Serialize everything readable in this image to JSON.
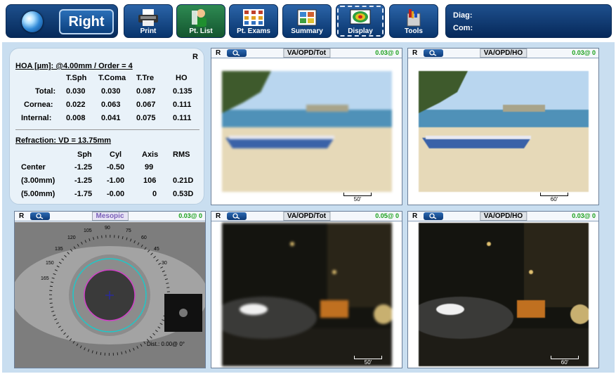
{
  "toolbar": {
    "eye_button": {
      "label": "Right"
    },
    "buttons": [
      {
        "label": "Print",
        "icon": "printer-icon"
      },
      {
        "label": "Pt. List",
        "icon": "patient-icon"
      },
      {
        "label": "Pt. Exams",
        "icon": "exams-grid-icon"
      },
      {
        "label": "Summary",
        "icon": "summary-icon"
      },
      {
        "label": "Display",
        "icon": "display-map-icon"
      },
      {
        "label": "Tools",
        "icon": "tools-icon"
      }
    ],
    "diag_label": "Diag:",
    "com_label": "Com:"
  },
  "info": {
    "eye": "R",
    "hoa_title": "HOA [µm]: @4.00mm / Order = 4",
    "hoa_headers": [
      "T.Sph",
      "T.Coma",
      "T.Tre",
      "HO"
    ],
    "hoa_rows": [
      {
        "label": "Total:",
        "values": [
          "0.030",
          "0.030",
          "0.087",
          "0.135"
        ]
      },
      {
        "label": "Cornea:",
        "values": [
          "0.022",
          "0.063",
          "0.067",
          "0.111"
        ]
      },
      {
        "label": "Internal:",
        "values": [
          "0.008",
          "0.041",
          "0.075",
          "0.111"
        ]
      }
    ],
    "refr_title": "Refraction: VD = 13.75mm",
    "refr_headers": [
      "Sph",
      "Cyl",
      "Axis",
      "RMS"
    ],
    "refr_rows": [
      {
        "label": "Center",
        "values": [
          "-1.25",
          "-0.50",
          "99",
          ""
        ]
      },
      {
        "label": "(3.00mm)",
        "values": [
          "-1.25",
          "-1.00",
          "106",
          "0.21D"
        ]
      },
      {
        "label": "(5.00mm)",
        "values": [
          "-1.75",
          "-0.00",
          "0",
          "0.53D"
        ]
      }
    ]
  },
  "panels": {
    "top_mid": {
      "eye": "R",
      "title": "VA/OPD/Tot",
      "value": "0.03@ 0",
      "scale": "50'"
    },
    "top_right": {
      "eye": "R",
      "title": "VA/OPD/HO",
      "value": "0.03@ 0",
      "scale": "60'"
    },
    "eye_image": {
      "eye": "R",
      "title": "Mesopic",
      "value": "0.03@ 0",
      "dist": "Dist.: 0.00@ 0°",
      "angles": [
        "90",
        "75",
        "60",
        "45",
        "30",
        "105",
        "120",
        "135",
        "150",
        "165"
      ]
    },
    "bot_mid": {
      "eye": "R",
      "title": "VA/OPD/Tot",
      "value": "0.05@ 0",
      "scale": "50'"
    },
    "bot_right": {
      "eye": "R",
      "title": "VA/OPD/HO",
      "value": "0.03@ 0",
      "scale": "60'"
    }
  },
  "colors": {
    "toolbar_blue": "#0b3f7c",
    "panel_bg": "#c9def0",
    "value_green": "#1aa01a",
    "limbus_cyan": "#1ec8c8",
    "pupil_magenta": "#d040c8"
  }
}
